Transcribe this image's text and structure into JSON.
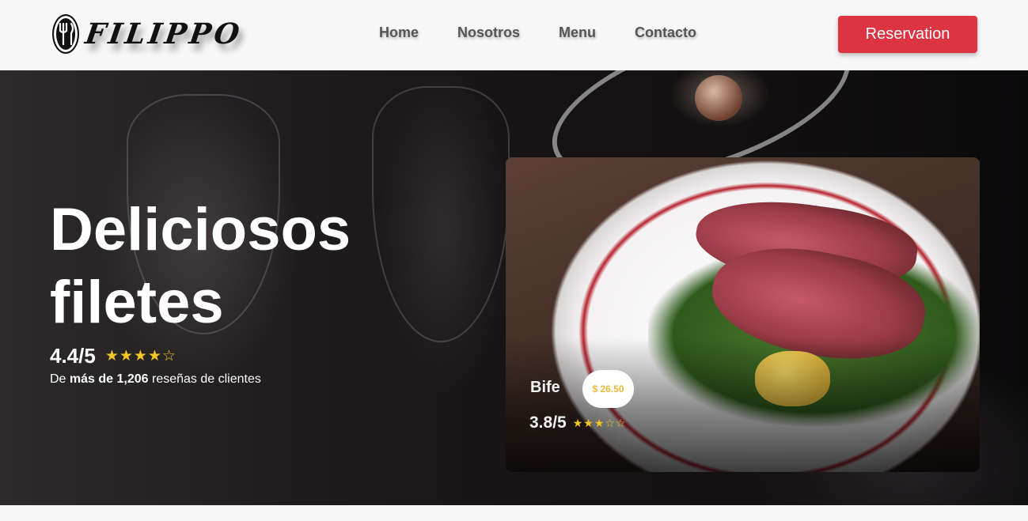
{
  "brand": {
    "name": "FILIPPO",
    "logo_icon": "fork-knife-icon"
  },
  "nav": {
    "links": [
      "Home",
      "Nosotros",
      "Menu",
      "Contacto"
    ],
    "cta_label": "Reservation",
    "cta_color": "#dd3444"
  },
  "hero": {
    "title_line1": "Deliciosos",
    "title_line2": "filetes",
    "rating": "4.4/5",
    "rating_value": 4.4,
    "stars": "★★★★☆",
    "reviews_prefix": "De",
    "reviews_bold": "más de 1,206",
    "reviews_suffix": "reseñas de clientes"
  },
  "dish": {
    "name": "Bife",
    "price": "$ 26.50",
    "rating": "3.8/5",
    "rating_value": 3.8,
    "stars": "★★★☆☆"
  },
  "colors": {
    "star": "#f3c623",
    "price_text": "#e7b93b"
  }
}
